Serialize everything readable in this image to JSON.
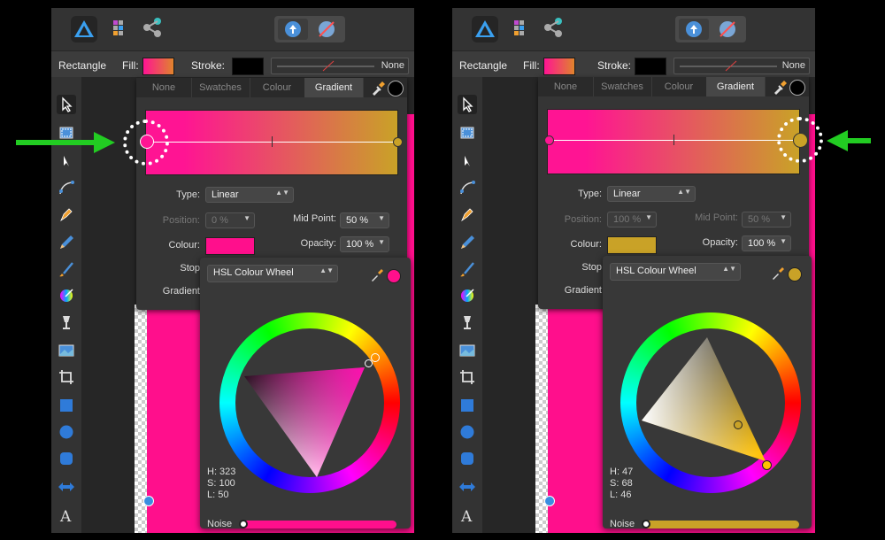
{
  "context_bar": {
    "shape_label": "Rectangle",
    "fill_label": "Fill:",
    "stroke_label": "Stroke:",
    "stroke_value": "None"
  },
  "tabs": [
    "None",
    "Swatches",
    "Colour",
    "Gradient"
  ],
  "labels": {
    "type": "Type:",
    "position": "Position:",
    "mid_point": "Mid Point:",
    "colour": "Colour:",
    "opacity": "Opacity:",
    "stop": "Stop",
    "gradient": "Gradient",
    "noise": "Noise"
  },
  "left": {
    "type_value": "Linear",
    "position_value": "0 %",
    "mid_point_value": "50 %",
    "opacity_value": "100 %",
    "colour_mode": "HSL Colour Wheel",
    "colour_hex": "#ff0f8c",
    "h": "H: 323",
    "s": "S: 100",
    "l": "L: 50"
  },
  "right": {
    "type_value": "Linear",
    "position_value": "100 %",
    "mid_point_value": "50 %",
    "opacity_value": "100 %",
    "colour_mode": "HSL Colour Wheel",
    "colour_hex": "#c9a227",
    "h": "H: 47",
    "s": "S: 68",
    "l": "L: 46"
  },
  "colors": {
    "gradient_start": "#ff1493",
    "gradient_end": "#c9a227",
    "accent_arrow": "#22cc22",
    "canvas_pink": "#ff0f8c"
  },
  "icons": [
    "designer-logo-icon",
    "pixel-persona-icon",
    "export-persona-icon",
    "upload-icon",
    "no-fill-icon",
    "eyedropper-icon",
    "move-tool-icon",
    "artboard-tool-icon",
    "node-tool-icon",
    "corner-tool-icon",
    "pen-tool-icon",
    "pencil-tool-icon",
    "brush-tool-icon",
    "fill-tool-icon",
    "transparency-tool-icon",
    "place-image-icon",
    "crop-tool-icon",
    "rectangle-tool-icon",
    "ellipse-tool-icon",
    "rounded-rect-tool-icon",
    "arrow-shape-tool-icon",
    "text-tool-icon"
  ]
}
